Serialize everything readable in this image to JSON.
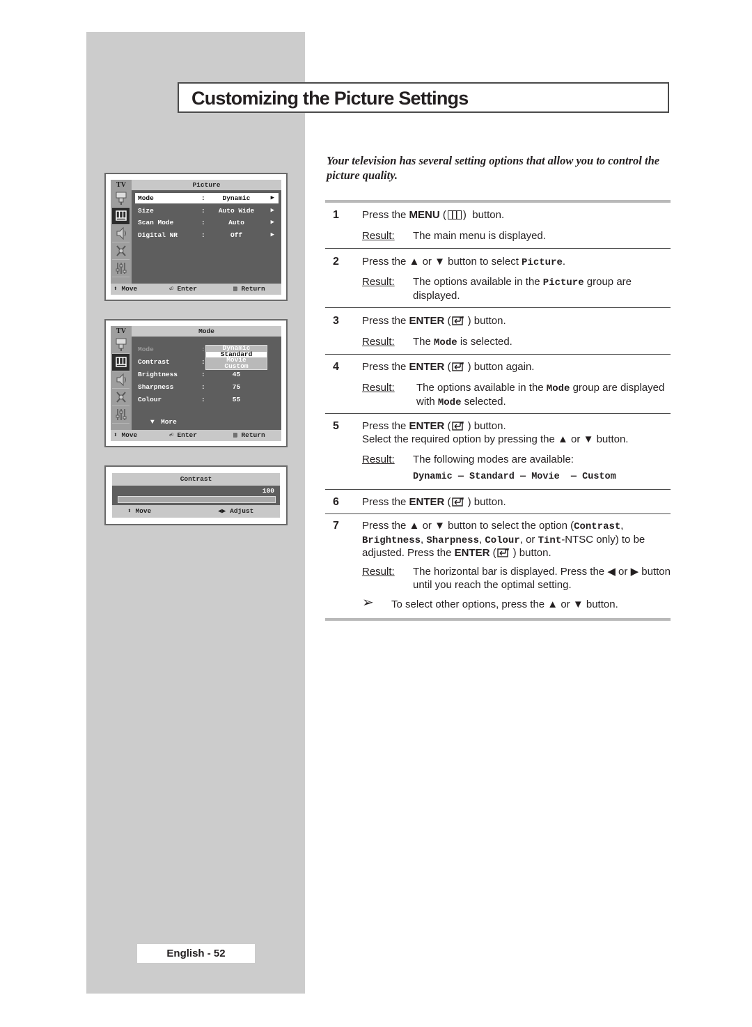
{
  "page": {
    "title": "Customizing the Picture Settings",
    "intro": "Your television has several setting options that allow you to control the picture quality.",
    "footer": "English - 52"
  },
  "common": {
    "result_label": "Result:",
    "press_the": "Press the",
    "or": "or",
    "enter": "ENTER",
    "button": "button.",
    "up_icon": "▲",
    "down_icon": "▼",
    "left_icon": "◀",
    "right_icon": "▶"
  },
  "steps": [
    {
      "num": "1",
      "key": "MENU",
      "after": "button.",
      "result": "The main menu is displayed."
    },
    {
      "num": "2",
      "text_a": "button to select",
      "code": "Picture",
      "result_a": "The options available in the",
      "result_code": "Picture",
      "result_b": "group are displayed."
    },
    {
      "num": "3",
      "after": "button.",
      "result_a": "The",
      "result_code": "Mode",
      "result_b": "is selected."
    },
    {
      "num": "4",
      "after": "button again.",
      "result_a": "The options available in the",
      "result_code": "Mode",
      "result_b": "group are displayed with",
      "result_code2": "Mode",
      "result_c": "selected."
    },
    {
      "num": "5",
      "after": "button.",
      "line2_a": "Select the required option by pressing the",
      "line2_b": "button.",
      "result": "The following modes are available:",
      "modes": [
        "Dynamic",
        "Standard",
        "Movie",
        "Custom"
      ],
      "mode_sep": "—"
    },
    {
      "num": "6",
      "after": "button."
    },
    {
      "num": "7",
      "text_a": "button to select the option (",
      "options": [
        "Contrast",
        "Brightness",
        "Sharpness",
        "Colour",
        "Tint"
      ],
      "text_b": "-NTSC only) to be adjusted. Press the",
      "result_a": "The horizontal bar is displayed. Press the",
      "result_b": "button until you reach the optimal setting.",
      "note_icon": "➢",
      "note": "To select other options, press the"
    }
  ],
  "screens": {
    "picture_menu": {
      "tv_label": "TV",
      "title": "Picture",
      "rows": [
        {
          "label": "Mode",
          "value": "Dynamic"
        },
        {
          "label": "Size",
          "value": "Auto Wide"
        },
        {
          "label": "Scan Mode",
          "value": "Auto"
        },
        {
          "label": "Digital NR",
          "value": "Off"
        }
      ],
      "footer": {
        "move": "Move",
        "enter": "Enter",
        "return": "Return"
      }
    },
    "mode_menu": {
      "tv_label": "TV",
      "title": "Mode",
      "rows": [
        {
          "label": "Mode",
          "value": ""
        },
        {
          "label": "Contrast",
          "value": ""
        },
        {
          "label": "Brightness",
          "value": "45"
        },
        {
          "label": "Sharpness",
          "value": "75"
        },
        {
          "label": "Colour",
          "value": "55"
        }
      ],
      "popup": [
        "Dynamic",
        "Standard",
        "Movie",
        "Custom"
      ],
      "popup_selected": "Standard",
      "more": "More",
      "footer": {
        "move": "Move",
        "enter": "Enter",
        "return": "Return"
      }
    },
    "contrast_bar": {
      "title": "Contrast",
      "value": "100",
      "level_percent": 100,
      "footer": {
        "move": "Move",
        "adjust": "Adjust"
      }
    }
  }
}
